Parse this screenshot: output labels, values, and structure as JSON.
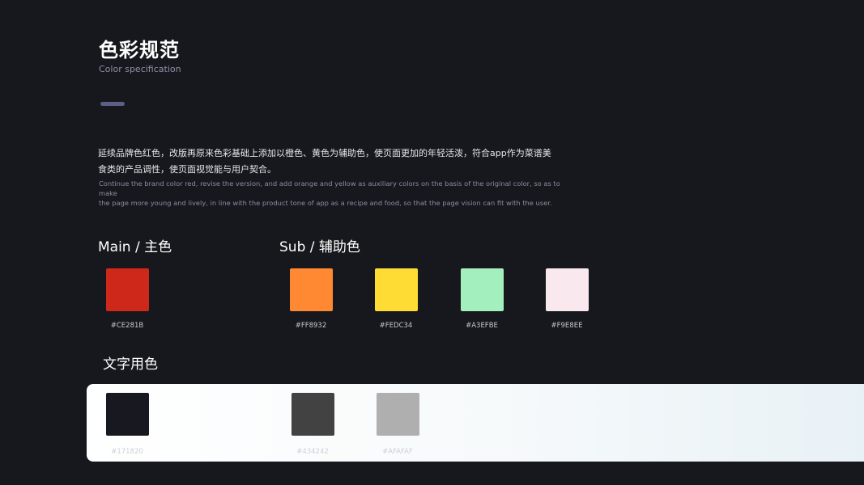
{
  "header": {
    "title": "色彩规范",
    "subtitle": "Color specification"
  },
  "description": {
    "cn_line1": "延续品牌色红色，改版再原来色彩基础上添加以橙色、黄色为辅助色，使页面更加的年轻活泼，符合app作为菜谱美",
    "cn_line2": "食类的产品调性，使页面视觉能与用户契合。",
    "en_line1": "Continue the brand color red, revise the version, and add orange and yellow as auxiliary colors on the basis of the original color, so as to make",
    "en_line2": "the page more young and lively, in line with the product tone of app as a recipe and food, so that the page vision can fit with the user."
  },
  "main": {
    "label": "Main / 主色",
    "colors": [
      {
        "code": "#CE281B",
        "hex": "#CE281B"
      }
    ]
  },
  "sub": {
    "label": "Sub / 辅助色",
    "colors": [
      {
        "code": "#FF8932",
        "hex": "#FF8932"
      },
      {
        "code": "#FEDC34",
        "hex": "#FEDC34"
      },
      {
        "code": "#A3EFBE",
        "hex": "#A3EFBE"
      },
      {
        "code": "#F9E8EE",
        "hex": "#F9E8EE"
      }
    ]
  },
  "text_colors": {
    "label": "文字用色",
    "colors": [
      {
        "code": "#171820",
        "hex": "#171820"
      },
      {
        "code": "#434242",
        "hex": "#434242"
      },
      {
        "code": "#AFAFAF",
        "hex": "#AFAFAF"
      }
    ]
  },
  "theme": {
    "background": "#17181D",
    "accent_bar": "#5C5F85"
  }
}
